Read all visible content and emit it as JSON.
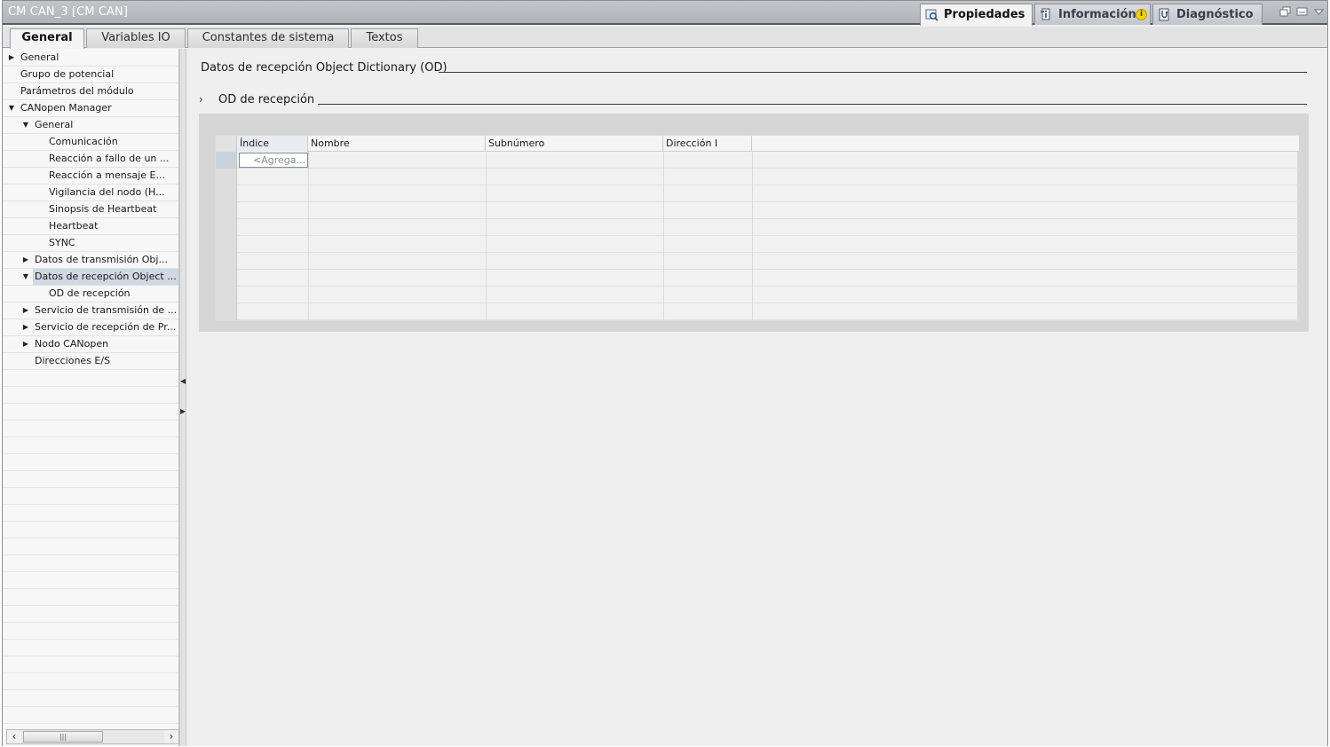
{
  "window": {
    "title": "CM CAN_3 [CM CAN]"
  },
  "inspector_tabs": [
    {
      "label": "Propiedades",
      "icon": "properties-icon",
      "active": true
    },
    {
      "label": "Información",
      "icon": "info-icon",
      "badge": "i"
    },
    {
      "label": "Diagnóstico",
      "icon": "diagnostics-icon"
    }
  ],
  "sub_tabs": [
    {
      "label": "General",
      "active": true
    },
    {
      "label": "Variables IO"
    },
    {
      "label": "Constantes de sistema"
    },
    {
      "label": "Textos"
    }
  ],
  "nav": {
    "items": [
      {
        "label": "General",
        "toggle": "▶"
      },
      {
        "label": "Grupo de potencial",
        "toggle": ""
      },
      {
        "label": "Parámetros del módulo",
        "toggle": ""
      },
      {
        "label": "CANopen Manager",
        "toggle": "▼"
      },
      {
        "label": "General",
        "toggle": "▼"
      },
      {
        "label": "Comunicación",
        "toggle": ""
      },
      {
        "label": "Reacción a fallo de un ...",
        "toggle": ""
      },
      {
        "label": "Reacción a mensaje E...",
        "toggle": ""
      },
      {
        "label": "Vigilancia del nodo (H...",
        "toggle": ""
      },
      {
        "label": "Sinopsis de Heartbeat",
        "toggle": ""
      },
      {
        "label": "Heartbeat",
        "toggle": ""
      },
      {
        "label": "SYNC",
        "toggle": ""
      },
      {
        "label": "Datos de transmisión Obj...",
        "toggle": "▶"
      },
      {
        "label": "Datos de recepción Object ...",
        "toggle": "▼",
        "selected": true
      },
      {
        "label": "OD de recepción",
        "toggle": ""
      },
      {
        "label": "Servicio de transmisión de ...",
        "toggle": "▶"
      },
      {
        "label": "Servicio de recepción de Pr...",
        "toggle": "▶"
      },
      {
        "label": "Nodo CANopen",
        "toggle": "▶"
      },
      {
        "label": "Direcciones E/S",
        "toggle": ""
      }
    ]
  },
  "main": {
    "section_title": "Datos de recepción Object Dictionary (OD)",
    "subsection_toggle": "›",
    "subsection_title": "OD de recepción",
    "table": {
      "columns": [
        "Índice",
        "Nombre",
        "Subnúmero",
        "Dirección I"
      ],
      "add_placeholder": "<Agrega..."
    }
  }
}
